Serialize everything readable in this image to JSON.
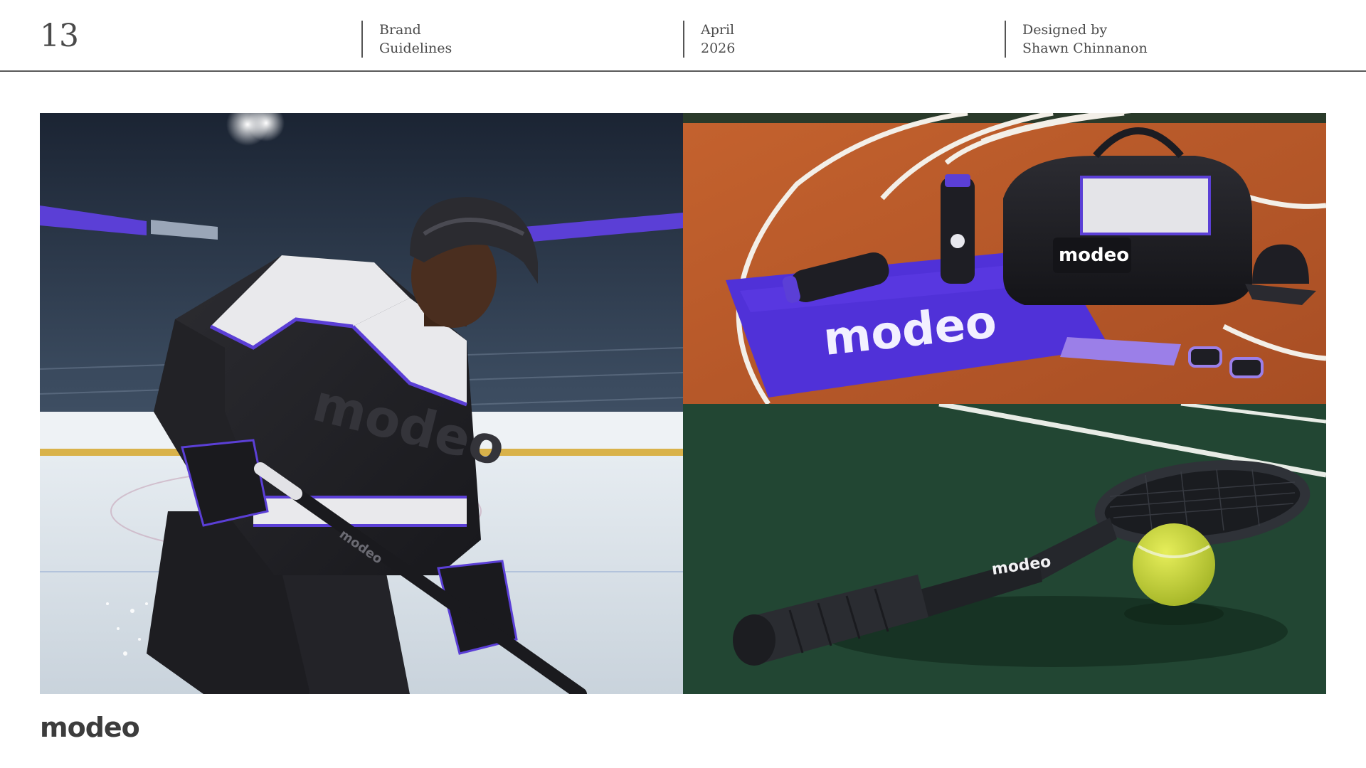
{
  "header": {
    "page_number": "13",
    "columns": [
      {
        "line1": "Brand",
        "line2": "Guidelines"
      },
      {
        "line1": "April",
        "line2": "2026"
      },
      {
        "line1": "Designed by",
        "line2": "Shawn Chinnanon"
      }
    ]
  },
  "photos": {
    "hockey": {
      "jersey_wordmark": "modeo",
      "stick_wordmark": "modeo"
    },
    "track": {
      "towel_wordmark": "modeo",
      "bag_wordmark": "modeo"
    },
    "tennis": {
      "racket_wordmark": "modeo"
    }
  },
  "brand": {
    "logo_text": "modeo",
    "colors": {
      "purple": "#5b3fd6",
      "lavender": "#9b7fe8",
      "black": "#1e1e22",
      "court_green": "#254a36",
      "track_orange": "#b8582a"
    }
  }
}
